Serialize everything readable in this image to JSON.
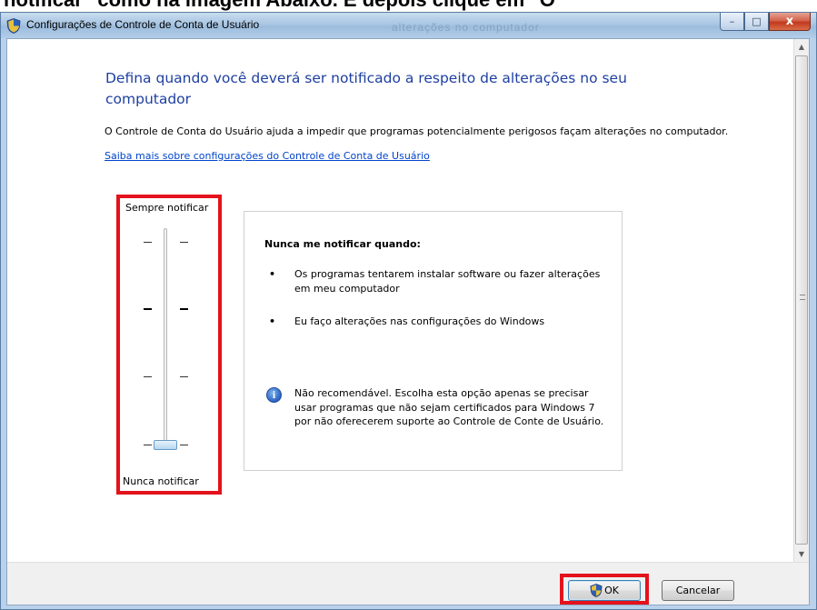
{
  "banner": {
    "text": "notificar\" como na imagem Abaixo. E depois clique em \"O"
  },
  "window": {
    "title": "Configurações de Controle de Conta de Usuário",
    "ghost_title": "alterações no computador",
    "caption": {
      "minimize": "–",
      "maximize": "□",
      "close": "x"
    }
  },
  "main": {
    "heading": "Defina quando você deverá ser notificado a respeito de alterações no seu computador",
    "description": "O Controle de Conta do Usuário ajuda a impedir que programas potencialmente perigosos façam alterações no computador.",
    "learn_more_link": "Saiba mais sobre configurações do Controle de Conta de Usuário"
  },
  "slider": {
    "top_label": "Sempre notificar",
    "bottom_label": "Nunca notificar",
    "levels": 4,
    "selected_level": 1
  },
  "panel": {
    "title": "Nunca me notificar quando:",
    "bullets": [
      "Os programas tentarem instalar software ou fazer alterações em meu computador",
      "Eu faço alterações nas configurações do Windows"
    ],
    "bullet_symbol": "•",
    "info_icon": "i",
    "info_text": "Não recomendável. Escolha esta opção apenas se precisar usar programas que não sejam certificados para Windows 7 por não oferecerem suporte ao Controle de Conte de Usuário."
  },
  "footer": {
    "ok_label": "OK",
    "cancel_label": "Cancelar"
  },
  "colors": {
    "heading": "#1e3fa0",
    "link": "#0044cc",
    "highlight": "#e3121c"
  }
}
